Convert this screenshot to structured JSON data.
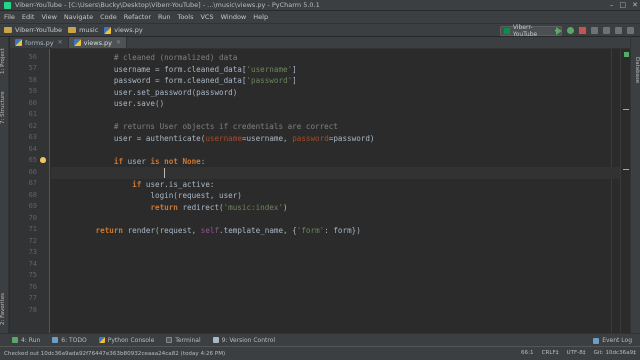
{
  "window": {
    "title": "Viberr-YouTube - [C:\\Users\\Bucky\\Desktop\\Viberr-YouTube] - ...\\music\\views.py - PyCharm 5.0.1",
    "controls": [
      "–",
      "□",
      "✕"
    ]
  },
  "menu": [
    "File",
    "Edit",
    "View",
    "Navigate",
    "Code",
    "Refactor",
    "Run",
    "Tools",
    "VCS",
    "Window",
    "Help"
  ],
  "breadcrumbs": [
    "Viberr-YouTube",
    "music",
    "views.py"
  ],
  "run_config": "Viberr-YouTube",
  "tabs": [
    {
      "label": "forms.py",
      "active": false
    },
    {
      "label": "views.py",
      "active": true
    }
  ],
  "side_tabs": {
    "project": "1: Project",
    "structure": "7: Structure",
    "favorites": "2: Favorites",
    "database": "Database"
  },
  "line_numbers": [
    "56",
    "57",
    "58",
    "59",
    "60",
    "61",
    "62",
    "63",
    "64",
    "65",
    "66",
    "67",
    "68",
    "69",
    "70",
    "71",
    "72",
    "73",
    "74",
    "75",
    "76",
    "77",
    "78"
  ],
  "bottom_tools": [
    "4: Run",
    "6: TODO",
    "Python Console",
    "Terminal",
    "9: Version Control"
  ],
  "event_log": "Event Log",
  "status": {
    "message": "Checked out 10dc36a9ada92f76447e363b80932ceaaa24ca82 (today 4:26 PM)",
    "position": "66:1",
    "line_sep": "CRLF‡",
    "encoding": "UTF-8‡",
    "git": "Git: 10dc36a9‡"
  },
  "colors": {
    "editor_bg": "#2b2b2b",
    "keyword": "#cc7832",
    "string": "#6a8759",
    "comment": "#808080",
    "param": "#aa4926",
    "self": "#94558d"
  }
}
